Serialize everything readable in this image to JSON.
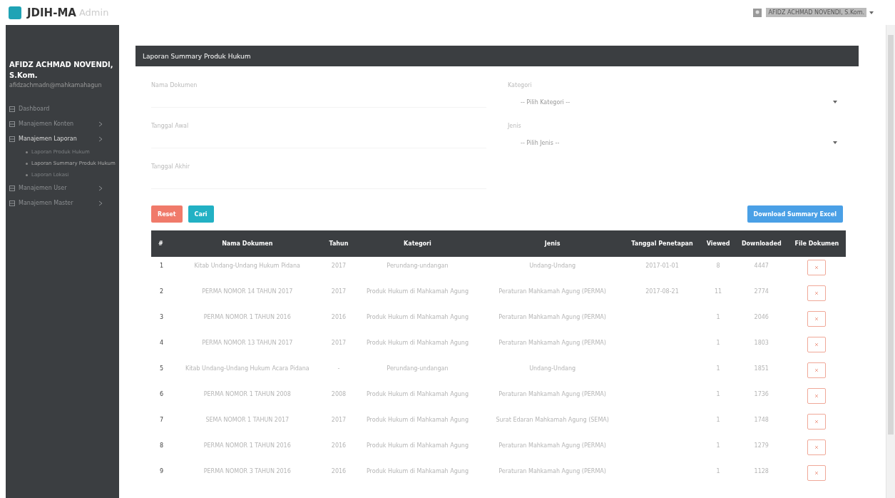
{
  "brand": {
    "logo": "JDIH-MA",
    "suffix": "Admin"
  },
  "top_user": {
    "name": "AFIDZ ACHMAD NOVENDI, S.Kom."
  },
  "sidebar": {
    "user_name": "AFIDZ ACHMAD NOVENDI, S.Kom.",
    "email": "afidzachmadn@mahkamahagun",
    "items": [
      {
        "label": "Dashboard",
        "expanded": false,
        "kind": "link"
      },
      {
        "label": "Manajemen Konten",
        "expanded": false,
        "kind": "group"
      },
      {
        "label": "Manajemen Laporan",
        "expanded": true,
        "kind": "group",
        "children": [
          {
            "label": "Laporan Produk Hukum",
            "selected": false
          },
          {
            "label": "Laporan Summary Produk Hukum",
            "selected": true
          },
          {
            "label": "Laporan Lokasi",
            "selected": false
          }
        ]
      },
      {
        "label": "Manajemen User",
        "expanded": false,
        "kind": "group"
      },
      {
        "label": "Manajemen Master",
        "expanded": false,
        "kind": "group"
      }
    ]
  },
  "panel": {
    "title": "Laporan Summary Produk Hukum",
    "filters": [
      {
        "kind": "input",
        "label": "Nama Dokumen"
      },
      {
        "kind": "select",
        "label": "Kategori",
        "placeholder": "-- Pilih Kategori --"
      },
      {
        "kind": "input",
        "label": "Tanggal Awal"
      },
      {
        "kind": "select",
        "label": "Jenis",
        "placeholder": "-- Pilih Jenis --"
      },
      {
        "kind": "input",
        "label": "Tanggal Akhir"
      }
    ],
    "buttons": [
      {
        "kind": "reset",
        "label": "Reset"
      },
      {
        "kind": "search",
        "label": "Cari"
      },
      {
        "kind": "download",
        "label": "Download Summary Excel"
      }
    ],
    "table": {
      "columns": [
        "#",
        "Nama Dokumen",
        "Tahun",
        "Kategori",
        "Jenis",
        "Tanggal Penetapan",
        "Viewed",
        "Downloaded",
        "File Dokumen"
      ],
      "rows": [
        [
          "1",
          "Kitab Undang-Undang Hukum Pidana",
          "2017",
          "Perundang-undangan",
          "Undang-Undang",
          "2017-01-01",
          "8",
          "4447"
        ],
        [
          "2",
          "PERMA NOMOR 14 TAHUN 2017",
          "2017",
          "Produk Hukum di Mahkamah Agung",
          "Peraturan Mahkamah Agung (PERMA)",
          "2017-08-21",
          "11",
          "2774"
        ],
        [
          "3",
          "PERMA NOMOR 1 TAHUN 2016",
          "2016",
          "Produk Hukum di Mahkamah Agung",
          "Peraturan Mahkamah Agung (PERMA)",
          "",
          "1",
          "2046"
        ],
        [
          "4",
          "PERMA NOMOR 13 TAHUN 2017",
          "2017",
          "Produk Hukum di Mahkamah Agung",
          "Peraturan Mahkamah Agung (PERMA)",
          "",
          "1",
          "1803"
        ],
        [
          "5",
          "Kitab Undang-Undang Hukum Acara Pidana",
          "-",
          "Perundang-undangan",
          "Undang-Undang",
          "",
          "1",
          "1851"
        ],
        [
          "6",
          "PERMA NOMOR 1 TAHUN 2008",
          "2008",
          "Produk Hukum di Mahkamah Agung",
          "Peraturan Mahkamah Agung (PERMA)",
          "",
          "1",
          "1736"
        ],
        [
          "7",
          "SEMA NOMOR 1 TAHUN 2017",
          "2017",
          "Produk Hukum di Mahkamah Agung",
          "Surat Edaran Mahkamah Agung (SEMA)",
          "",
          "1",
          "1748"
        ],
        [
          "8",
          "PERMA NOMOR 1 TAHUN 2016",
          "2016",
          "Produk Hukum di Mahkamah Agung",
          "Peraturan Mahkamah Agung (PERMA)",
          "",
          "1",
          "1279"
        ],
        [
          "9",
          "PERMA NOMOR 3 TAHUN 2016",
          "2016",
          "Produk Hukum di Mahkamah Agung",
          "Peraturan Mahkamah Agung (PERMA)",
          "",
          "1",
          "1128"
        ]
      ]
    }
  }
}
